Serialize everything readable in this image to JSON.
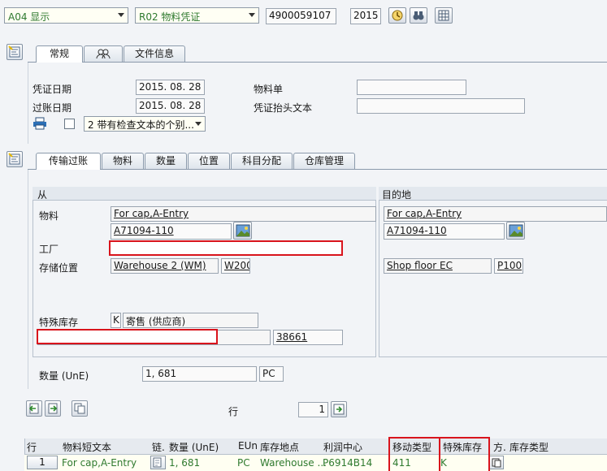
{
  "toolbar": {
    "action_combo": "A04 显示",
    "doc_type_combo": "R02 物料凭证",
    "doc_number": "4900059107",
    "year": "2015"
  },
  "header_tabs": [
    "常规",
    "",
    "文件信息"
  ],
  "general": {
    "doc_date_label": "凭证日期",
    "doc_date": "2015. 08. 28",
    "post_date_label": "过账日期",
    "post_date": "2015. 08. 28",
    "material_slip_label": "物料单",
    "material_slip": "",
    "header_text_label": "凭证抬头文本",
    "header_text": "",
    "print_option": "2 带有检查文本的个别..."
  },
  "item_tabs": [
    "传输过账",
    "物料",
    "数量",
    "位置",
    "科目分配",
    "仓库管理"
  ],
  "transfer": {
    "from_label": "从",
    "to_label": "目的地",
    "material_label": "物料",
    "from_material_desc": "For cap,A-Entry",
    "from_material": "A71094-110",
    "plant_label": "工厂",
    "storage_label": "存储位置",
    "from_storage_desc": "Warehouse 2 (WM)",
    "from_storage": "W200",
    "special_stock_label": "特殊库存",
    "special_stock_code": "K",
    "special_stock_desc": "寄售 (供应商)",
    "vendor": "38661",
    "to_material_desc": "For cap,A-Entry",
    "to_material": "A71094-110",
    "to_storage_desc": "Shop floor EC",
    "to_storage": "P100"
  },
  "quantity": {
    "label": "数量 (UnE)",
    "value": "1, 681",
    "unit": "PC"
  },
  "row_nav": {
    "label": "行",
    "value": "1"
  },
  "grid": {
    "headers": [
      "行",
      "物料短文本",
      "链.",
      "数量 (UnE)",
      "EUn",
      "库存地点",
      "利润中心",
      "移动类型",
      "特殊库存",
      "方.",
      "库存类型"
    ],
    "row": {
      "line": "1",
      "material_text": "For cap,A-Entry",
      "quantity": "1, 681",
      "unit": "PC",
      "storage": "Warehouse ...",
      "profit_center": "P6914B14",
      "movement_type": "411",
      "special_stock": "K"
    }
  },
  "colors": {
    "highlight": "#d9141c",
    "value_green": "#2f7a2f"
  }
}
